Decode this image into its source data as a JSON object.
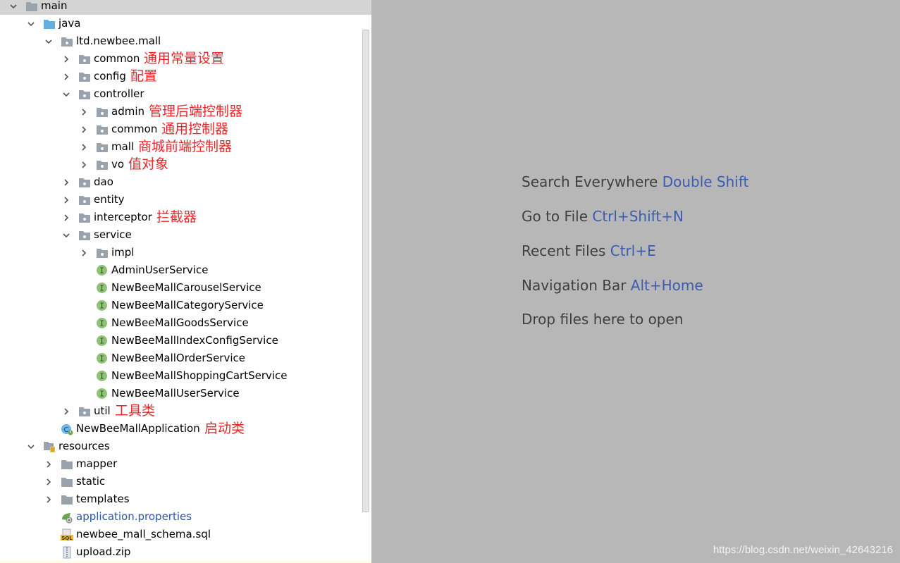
{
  "tree": [
    {
      "label": "main",
      "type": "folder-gray",
      "depth": 0,
      "state": "open",
      "selected": true
    },
    {
      "label": "java",
      "type": "folder-blue",
      "depth": 1,
      "state": "open"
    },
    {
      "label": "ltd.newbee.mall",
      "type": "package",
      "depth": 2,
      "state": "open"
    },
    {
      "label": "common",
      "type": "package",
      "depth": 3,
      "state": "closed",
      "note": "通用常量设置"
    },
    {
      "label": "config",
      "type": "package",
      "depth": 3,
      "state": "closed",
      "note": "配置"
    },
    {
      "label": "controller",
      "type": "package",
      "depth": 3,
      "state": "open"
    },
    {
      "label": "admin",
      "type": "package",
      "depth": 4,
      "state": "closed",
      "note": "管理后端控制器"
    },
    {
      "label": "common",
      "type": "package",
      "depth": 4,
      "state": "closed",
      "note": "通用控制器"
    },
    {
      "label": "mall",
      "type": "package",
      "depth": 4,
      "state": "closed",
      "note": "商城前端控制器"
    },
    {
      "label": "vo",
      "type": "package",
      "depth": 4,
      "state": "closed",
      "note": "值对象"
    },
    {
      "label": "dao",
      "type": "package",
      "depth": 3,
      "state": "closed"
    },
    {
      "label": "entity",
      "type": "package",
      "depth": 3,
      "state": "closed"
    },
    {
      "label": "interceptor",
      "type": "package",
      "depth": 3,
      "state": "closed",
      "note": "拦截器"
    },
    {
      "label": "service",
      "type": "package",
      "depth": 3,
      "state": "open"
    },
    {
      "label": "impl",
      "type": "package",
      "depth": 4,
      "state": "closed"
    },
    {
      "label": "AdminUserService",
      "type": "interface",
      "depth": 4,
      "state": "none"
    },
    {
      "label": "NewBeeMallCarouselService",
      "type": "interface",
      "depth": 4,
      "state": "none"
    },
    {
      "label": "NewBeeMallCategoryService",
      "type": "interface",
      "depth": 4,
      "state": "none"
    },
    {
      "label": "NewBeeMallGoodsService",
      "type": "interface",
      "depth": 4,
      "state": "none"
    },
    {
      "label": "NewBeeMallIndexConfigService",
      "type": "interface",
      "depth": 4,
      "state": "none"
    },
    {
      "label": "NewBeeMallOrderService",
      "type": "interface",
      "depth": 4,
      "state": "none"
    },
    {
      "label": "NewBeeMallShoppingCartService",
      "type": "interface",
      "depth": 4,
      "state": "none"
    },
    {
      "label": "NewBeeMallUserService",
      "type": "interface",
      "depth": 4,
      "state": "none"
    },
    {
      "label": "util",
      "type": "package",
      "depth": 3,
      "state": "closed",
      "note": "工具类"
    },
    {
      "label": "NewBeeMallApplication",
      "type": "spring-class",
      "depth": 3,
      "state": "none",
      "note": "启动类"
    },
    {
      "label": "resources",
      "type": "resources",
      "depth": 1,
      "state": "open"
    },
    {
      "label": "mapper",
      "type": "folder-gray",
      "depth": 2,
      "state": "closed"
    },
    {
      "label": "static",
      "type": "folder-gray",
      "depth": 2,
      "state": "closed"
    },
    {
      "label": "templates",
      "type": "folder-gray",
      "depth": 2,
      "state": "closed"
    },
    {
      "label": "application.properties",
      "type": "properties",
      "depth": 2,
      "state": "none",
      "link": true
    },
    {
      "label": "newbee_mall_schema.sql",
      "type": "sql",
      "depth": 2,
      "state": "none"
    },
    {
      "label": "upload.zip",
      "type": "zip",
      "depth": 2,
      "state": "none"
    }
  ],
  "editor": {
    "hints": [
      {
        "text": "Search Everywhere",
        "shortcut": "Double Shift"
      },
      {
        "text": "Go to File",
        "shortcut": "Ctrl+Shift+N"
      },
      {
        "text": "Recent Files",
        "shortcut": "Ctrl+E"
      },
      {
        "text": "Navigation Bar",
        "shortcut": "Alt+Home"
      },
      {
        "text": "Drop files here to open",
        "shortcut": ""
      }
    ]
  },
  "watermark": "https://blog.csdn.net/weixin_42643216",
  "colors": {
    "note": "#e8272b",
    "shortcut": "#3b5cb0",
    "link": "#2a57a8",
    "interface_badge": "#8ec274",
    "folder_blue": "#64afe0",
    "folder_gray": "#9aa3ab"
  }
}
